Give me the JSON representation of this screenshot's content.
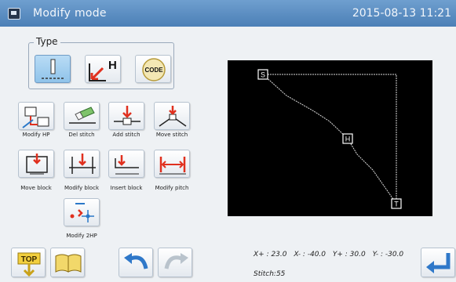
{
  "header": {
    "title": "Modify mode",
    "datetime": "2015-08-13 11:21"
  },
  "type_group": {
    "legend": "Type",
    "buttons": [
      {
        "name": "stitch-type-button",
        "label": "",
        "selected": true
      },
      {
        "name": "height-type-button",
        "label": "H"
      },
      {
        "name": "code-type-button",
        "label": "CODE"
      }
    ]
  },
  "edit_buttons": {
    "modify_hp": "Modify HP",
    "del_stitch": "Del stitch",
    "add_stitch": "Add stitch",
    "move_stitch": "Move stitch",
    "move_block": "Move block",
    "modify_block": "Modify block",
    "insert_block": "Insert block",
    "modify_pitch": "Modify pitch",
    "modify_2hp": "Modify 2HP"
  },
  "preview": {
    "markers": {
      "start": "S",
      "middle": "H",
      "end": "T"
    }
  },
  "readout": {
    "x_plus": "X+ : 23.0",
    "x_minus": "X- : -40.0",
    "y_plus": "Y+ : 30.0",
    "y_minus": "Y- : -30.0",
    "stitch": "Stitch:55"
  },
  "footer": {
    "top_label": "TOP"
  },
  "colors": {
    "title_bar": "#5b8cc2",
    "canvas": "#000000",
    "accent_red": "#e0301e"
  }
}
